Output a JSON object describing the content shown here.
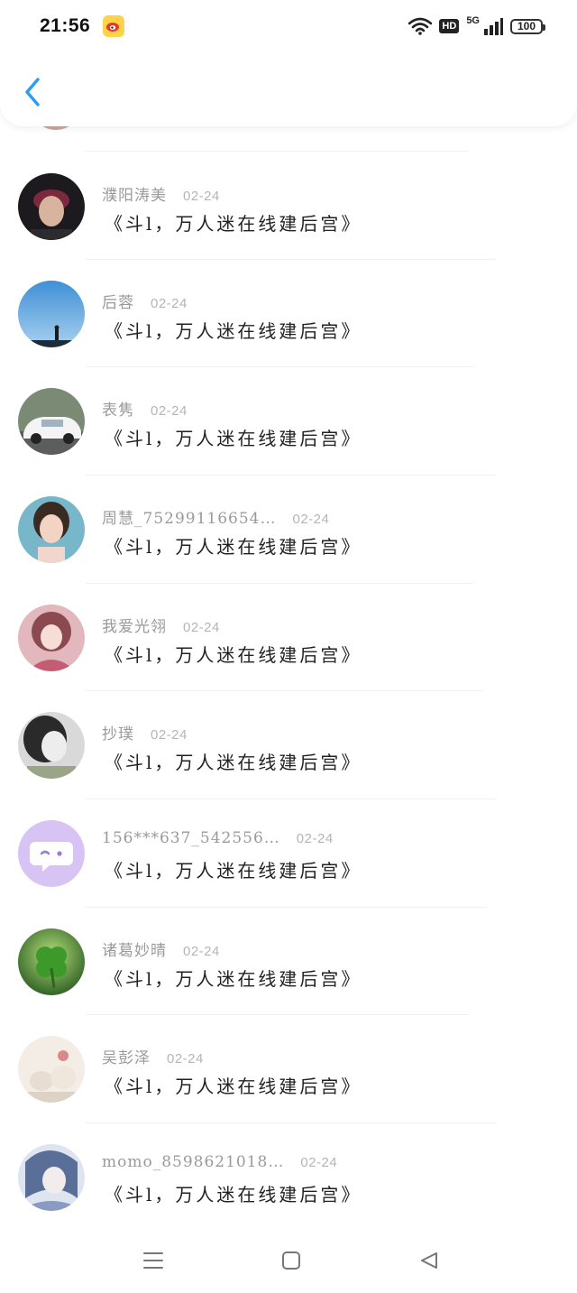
{
  "status_bar": {
    "time": "21:56",
    "hd": "HD",
    "network": "5G",
    "battery": "100"
  },
  "header": {
    "back_icon": "chevron-left-icon",
    "accent_color": "#2a9df4"
  },
  "messages": [
    {
      "name": "濮阳涛美",
      "date": "02-24",
      "text": "《斗l，万人迷在线建后宫》",
      "avatar": "young-man-cap"
    },
    {
      "name": "后蓉",
      "date": "02-24",
      "text": "《斗l，万人迷在线建后宫》",
      "avatar": "sky-silhouette"
    },
    {
      "name": "表隽",
      "date": "02-24",
      "text": "《斗l，万人迷在线建后宫》",
      "avatar": "white-car"
    },
    {
      "name": "周慧_75299116654…",
      "date": "02-24",
      "text": "《斗l，万人迷在线建后宫》",
      "avatar": "girl-portrait"
    },
    {
      "name": "我爱光翎",
      "date": "02-24",
      "text": "《斗l，万人迷在线建后宫》",
      "avatar": "anime-girl-pink"
    },
    {
      "name": "抄璞",
      "date": "02-24",
      "text": "《斗l，万人迷在线建后宫》",
      "avatar": "bw-girl"
    },
    {
      "name": "156***637_542556…",
      "date": "02-24",
      "text": "《斗l，万人迷在线建后宫》",
      "avatar": "default-chat-purple"
    },
    {
      "name": "诸葛妙晴",
      "date": "02-24",
      "text": "《斗l，万人迷在线建后宫》",
      "avatar": "clover-leaf"
    },
    {
      "name": "吴彭泽",
      "date": "02-24",
      "text": "《斗l，万人迷在线建后宫》",
      "avatar": "bunny-toys"
    },
    {
      "name": "momo_8598621018…",
      "date": "02-24",
      "text": "《斗l，万人迷在线建后宫》",
      "avatar": "anime-boy-blue"
    }
  ],
  "nav": {
    "menu_icon": "menu-icon",
    "home_icon": "home-square-icon",
    "back_icon": "back-triangle-icon"
  }
}
